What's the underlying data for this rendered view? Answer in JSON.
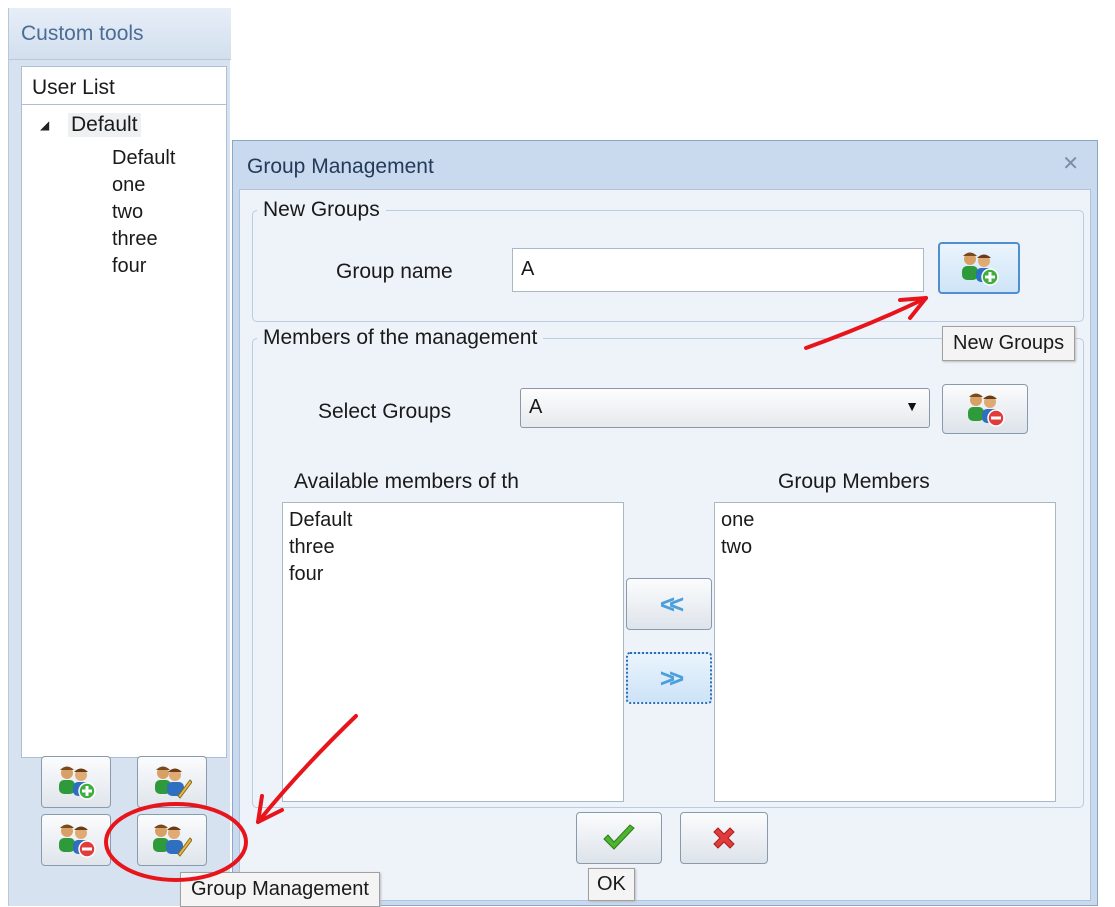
{
  "left_panel": {
    "header": "Custom tools",
    "user_list_header": "User List",
    "tree": {
      "root": "Default",
      "children": [
        "Default",
        "one",
        "two",
        "three",
        "four"
      ]
    },
    "buttons": [
      "add-user-icon",
      "edit-user-icon",
      "remove-user-icon",
      "group-management-icon"
    ]
  },
  "dialog": {
    "title": "Group Management",
    "new_groups": {
      "legend": "New Groups",
      "group_name_label": "Group name",
      "group_name_value": "A"
    },
    "members": {
      "legend": "Members of the management",
      "select_groups_label": "Select Groups",
      "selected_group": "A",
      "available_header": "Available members of th",
      "available_members": [
        "Default",
        "three",
        "four"
      ],
      "group_members_header": "Group Members",
      "group_members": [
        "one",
        "two"
      ]
    },
    "ok_tooltip": "OK"
  },
  "tooltips": {
    "new_groups": "New Groups",
    "group_management": "Group Management"
  },
  "colors": {
    "annotation": "#e8141c",
    "panel_header_text": "#4a6d96",
    "dialog_frame": "#c9d9ee"
  }
}
